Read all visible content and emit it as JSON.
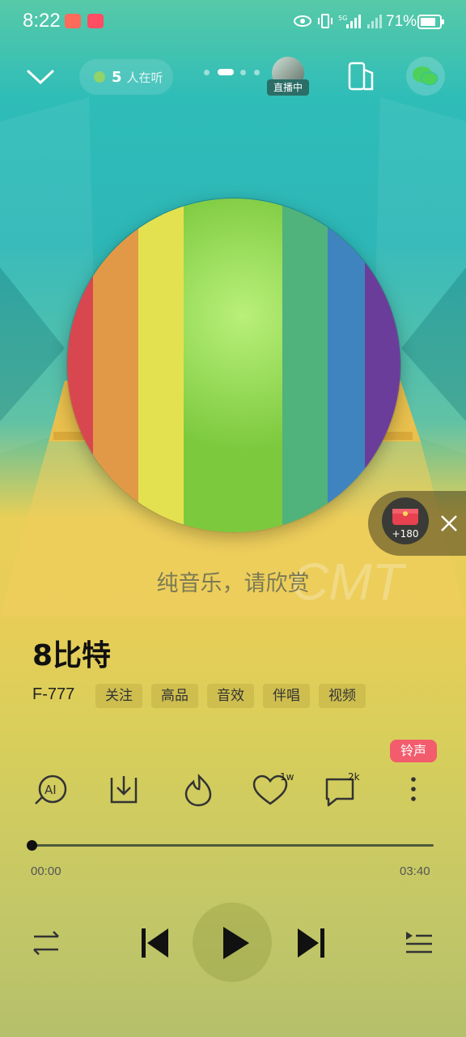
{
  "status_bar": {
    "time": "8:22",
    "battery": "71%",
    "network": "5G"
  },
  "header": {
    "listeners_count": "5",
    "listeners_label": "人在听",
    "live_label": "直播中"
  },
  "lyric": "纯音乐，请欣赏",
  "song": {
    "title": "8比特",
    "artist": "F-777",
    "tags": [
      "关注",
      "高品",
      "音效",
      "伴唱",
      "视频"
    ]
  },
  "actions": {
    "like_count": "1w",
    "comment_count": "2k",
    "ringtone_label": "铃声"
  },
  "progress": {
    "current": "00:00",
    "total": "03:40",
    "fraction": 0
  },
  "float_gift": {
    "label": "+180"
  },
  "colors": {
    "accent_red": "#f25c6c",
    "disc_stripes": [
      "#d8474f",
      "#e19947",
      "#e3e14f",
      "#7cc93e",
      "#4fb37b",
      "#3f83bf",
      "#6b3d9a"
    ]
  }
}
